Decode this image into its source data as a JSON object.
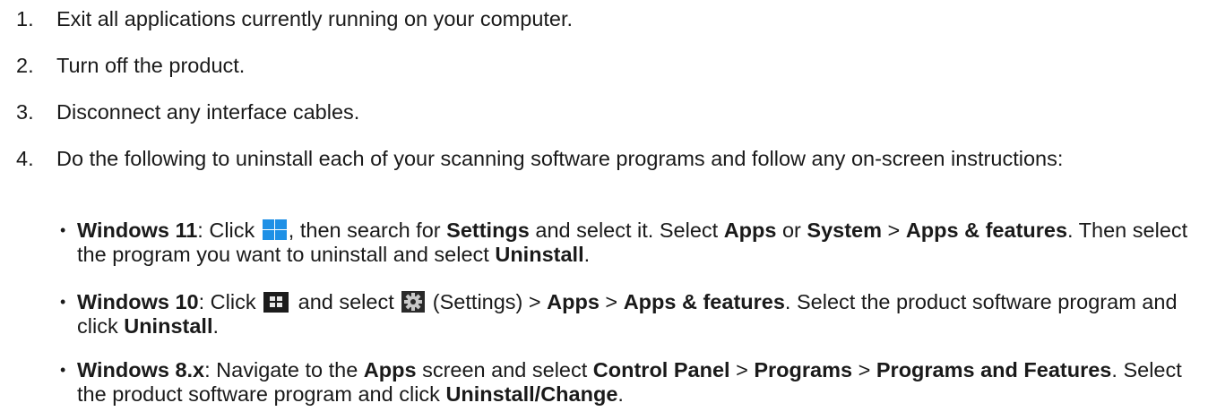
{
  "steps": [
    {
      "num": "1.",
      "text": "Exit all applications currently running on your computer."
    },
    {
      "num": "2.",
      "text": "Turn off the product."
    },
    {
      "num": "3.",
      "text": "Disconnect any interface cables."
    },
    {
      "num": "4.",
      "text": "Do the following to uninstall each of your scanning software programs and follow any on-screen instructions:"
    }
  ],
  "bullets": {
    "dot": "•",
    "win11": {
      "os": "Windows 11",
      "t1": ": Click ",
      "t2": ", then search for ",
      "settings": "Settings",
      "t3": " and select it. Select ",
      "apps": "Apps",
      "t4": " or ",
      "system": "System",
      "t5": " > ",
      "apps_features": "Apps & features",
      "t6": ". Then select the program you want to uninstall and select ",
      "uninstall": "Uninstall",
      "t7": "."
    },
    "win10": {
      "os": "Windows 10",
      "t1": ": Click ",
      "t2": " and select ",
      "t3": " (Settings) > ",
      "apps": "Apps",
      "t4": " > ",
      "apps_features": "Apps & features",
      "t5": ". Select the product software program and click ",
      "uninstall": "Uninstall",
      "t6": "."
    },
    "win8": {
      "os": "Windows 8.x",
      "t1": ": Navigate to the ",
      "apps": "Apps",
      "t2": " screen and select ",
      "control_panel": "Control Panel",
      "t3": " > ",
      "programs": "Programs",
      "t4": " > ",
      "programs_features": "Programs and Features",
      "t5": ". Select the product software program and click ",
      "uninstall_change": "Uninstall/Change",
      "t6": "."
    }
  },
  "icons": {
    "win11": "windows-11-start-icon",
    "win10": "windows-10-start-icon",
    "settings": "settings-gear-icon"
  },
  "colors": {
    "win11_blue": "#1e90e6",
    "text": "#1a1a1a"
  }
}
